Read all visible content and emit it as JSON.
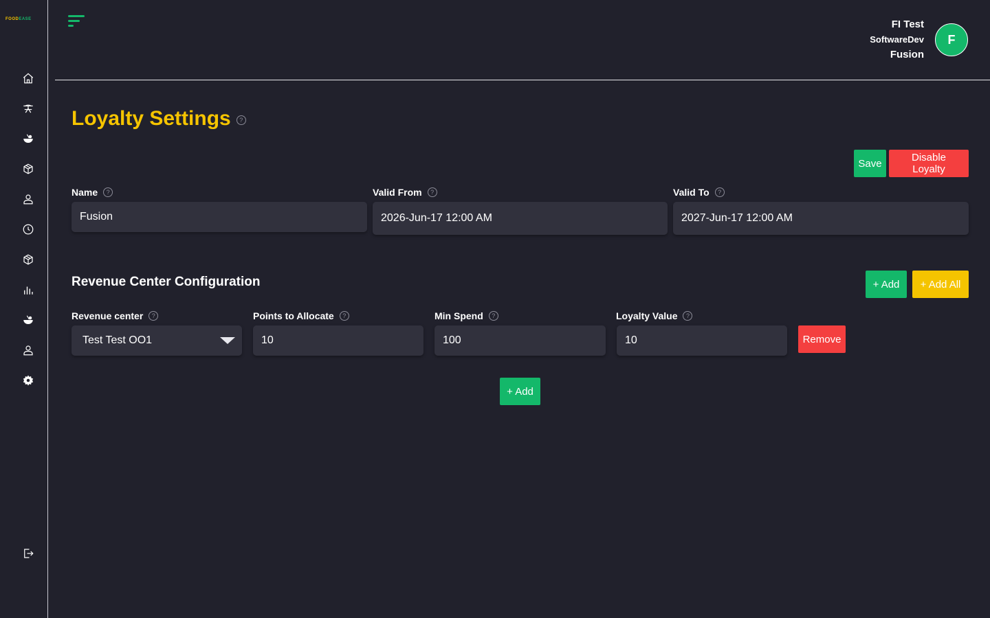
{
  "brand": {
    "logo_part1": "FOOD",
    "logo_part2": "EASE"
  },
  "sidebar": {
    "icons": [
      "home-icon",
      "dining-icon",
      "food-icon",
      "box-icon",
      "user-icon",
      "clock-icon",
      "package-icon",
      "chart-icon",
      "food-alt-icon",
      "profile-icon",
      "gear-icon"
    ],
    "logout_icon": "logout-icon"
  },
  "user": {
    "name": "FI Test",
    "role": "SoftwareDev",
    "org": "Fusion",
    "initial": "F"
  },
  "page": {
    "title": "Loyalty Settings"
  },
  "actions": {
    "save_label": "Save",
    "disable_label": "Disable Loyalty"
  },
  "form": {
    "name_label": "Name",
    "name_value": "Fusion",
    "valid_from_label": "Valid From",
    "valid_from_value": "2026-Jun-17 12:00 AM",
    "valid_to_label": "Valid To",
    "valid_to_value": "2027-Jun-17 12:00 AM"
  },
  "revenue": {
    "title": "Revenue Center Configuration",
    "add_label": "+ Add",
    "add_all_label": "+ Add All",
    "columns": {
      "center": "Revenue center",
      "points": "Points to Allocate",
      "min_spend": "Min Spend",
      "loyalty_value": "Loyalty Value"
    },
    "row": {
      "center": "Test Test OO1",
      "points": "10",
      "min_spend": "100",
      "loyalty_value": "10",
      "remove_label": "Remove"
    },
    "add_row_label": "+ Add"
  },
  "colors": {
    "accent_yellow": "#f5c400",
    "accent_green": "#14b86a",
    "danger_red": "#f43f3f",
    "background": "#21212c",
    "input_bg": "#31313d"
  }
}
